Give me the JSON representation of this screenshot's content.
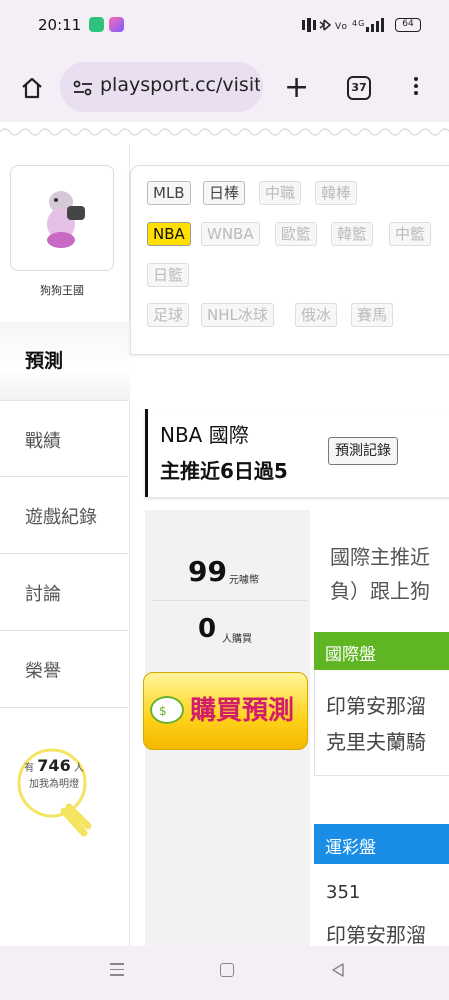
{
  "status_bar": {
    "time": "20:11",
    "right_icons": "▐▌ ✱ ☰ ⁴ᴳ▁▃▅",
    "battery": "64"
  },
  "browser": {
    "url": "playsport.cc/visit",
    "tab_count": "37"
  },
  "sidebar": {
    "username": "狗狗王國",
    "active_item": "預測",
    "items": [
      "戰績",
      "遊戲紀錄",
      "討論",
      "榮譽"
    ],
    "fans": {
      "prefix": "有",
      "count": "746",
      "unit": "人",
      "suffix": "加我為明燈"
    }
  },
  "leagues": {
    "row1": [
      "MLB",
      "日棒",
      "中職",
      "韓棒"
    ],
    "row2": [
      "NBA",
      "WNBA",
      "歐籃",
      "韓籃",
      "中籃"
    ],
    "row3": [
      "日籃"
    ],
    "row4": [
      "足球",
      "NHL冰球",
      "俄冰",
      "賽馬"
    ],
    "active": "NBA"
  },
  "prediction": {
    "league_line": "NBA 國際",
    "streak": "主推近6日過5",
    "record_button": "預測記錄",
    "price": "99",
    "price_unit": "元噱幣",
    "buyers": "0",
    "buyers_unit": "人購買",
    "buy_button": "購買預測",
    "description_line1": "國際主推近",
    "description_line2": "負）跟上狗",
    "intl_label": "國際盤",
    "intl_team1": "印第安那溜",
    "intl_team2": "克里夫蘭騎",
    "sports_lottery_label": "運彩盤",
    "lottery_number": "351",
    "lottery_team": "印第安那溜"
  },
  "colors": {
    "intl_header": "#5fb622",
    "lottery_header": "#1a8ee6",
    "active_league": "#ffe000",
    "buy_text": "#d11d6b"
  }
}
